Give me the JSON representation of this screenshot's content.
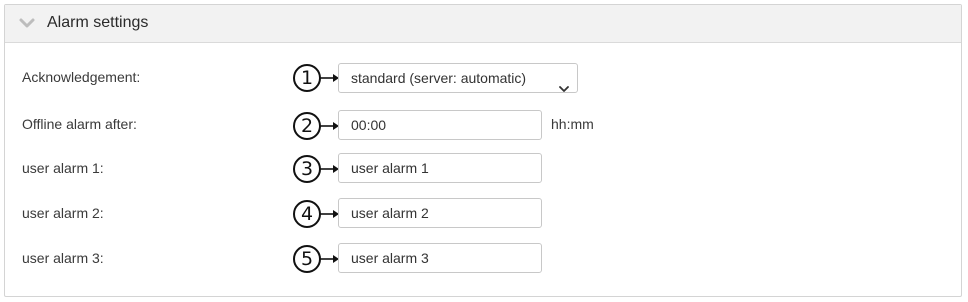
{
  "panel": {
    "title": "Alarm settings",
    "collapse_icon": "chevron-down-icon"
  },
  "rows": [
    {
      "callout": "1",
      "label": "Acknowledgement:",
      "type": "select",
      "value": "standard (server: automatic)"
    },
    {
      "callout": "2",
      "label": "Offline alarm after:",
      "type": "text",
      "value": "00:00",
      "unit": "hh:mm"
    },
    {
      "callout": "3",
      "label": "user alarm 1:",
      "type": "text",
      "value": "user alarm 1"
    },
    {
      "callout": "4",
      "label": "user alarm 2:",
      "type": "text",
      "value": "user alarm 2"
    },
    {
      "callout": "5",
      "label": "user alarm 3:",
      "type": "text",
      "value": "user alarm 3"
    }
  ],
  "colors": {
    "header_bg": "#f2f2f2",
    "border": "#d4d4d4",
    "field_border": "#c8c8c8"
  }
}
